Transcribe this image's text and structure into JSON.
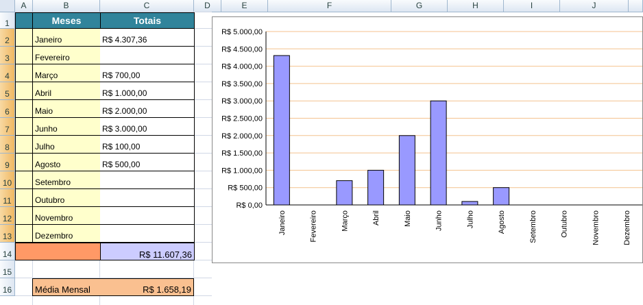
{
  "columns": [
    "A",
    "B",
    "C",
    "D",
    "E",
    "F",
    "G",
    "H",
    "I",
    "J"
  ],
  "rows": [
    "1",
    "2",
    "3",
    "4",
    "5",
    "6",
    "7",
    "8",
    "9",
    "10",
    "11",
    "12",
    "13",
    "14",
    "15",
    "16"
  ],
  "table": {
    "header_month": "Meses",
    "header_total": "Totais",
    "months": [
      "Janeiro",
      "Fevereiro",
      "Março",
      "Abril",
      "Maio",
      "Junho",
      "Julho",
      "Agosto",
      "Setembro",
      "Outubro",
      "Novembro",
      "Dezembro"
    ],
    "totals": [
      "R$ 4.307,36",
      "",
      "R$ 700,00",
      "R$ 1.000,00",
      "R$ 2.000,00",
      "R$ 3.000,00",
      "R$ 100,00",
      "R$ 500,00",
      "",
      "",
      "",
      ""
    ],
    "grand_total": "R$ 11.607,36",
    "average_label": "Média Mensal",
    "average_value": "R$ 1.658,19"
  },
  "colors": {
    "header_bg": "#31849b",
    "month_bg": "#ffffcc",
    "sum_label_bg": "#ff9966",
    "sum_value_bg": "#ccccff",
    "average_bg": "#fac090",
    "bar_fill": "#9999ff",
    "gridline": "#f4c28e"
  },
  "chart_data": {
    "type": "bar",
    "categories": [
      "Janeiro",
      "Fevereiro",
      "Março",
      "Abril",
      "Maio",
      "Junho",
      "Julho",
      "Agosto",
      "Setembro",
      "Outubro",
      "Novembro",
      "Dezembro"
    ],
    "values": [
      4307.36,
      0,
      700,
      1000,
      2000,
      3000,
      100,
      500,
      0,
      0,
      0,
      0
    ],
    "ylim": [
      0,
      5000
    ],
    "ytick_values": [
      0,
      500,
      1000,
      1500,
      2000,
      2500,
      3000,
      3500,
      4000,
      4500,
      5000
    ],
    "yticks": [
      "R$ 0,00",
      "R$ 500,00",
      "R$ 1.000,00",
      "R$ 1.500,00",
      "R$ 2.000,00",
      "R$ 2.500,00",
      "R$ 3.000,00",
      "R$ 3.500,00",
      "R$ 4.000,00",
      "R$ 4.500,00",
      "R$ 5.000,00"
    ],
    "grid": true,
    "legend": "none",
    "title": "",
    "xlabel": "",
    "ylabel": ""
  }
}
